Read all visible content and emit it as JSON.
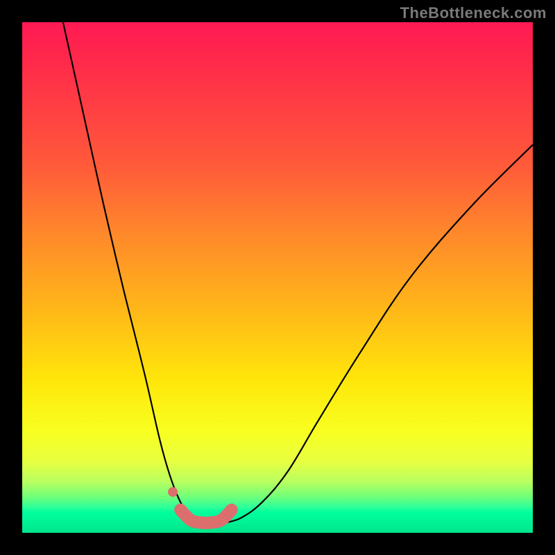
{
  "watermark": "TheBottleneck.com",
  "chart_data": {
    "type": "line",
    "title": "",
    "xlabel": "",
    "ylabel": "",
    "xlim": [
      0,
      100
    ],
    "ylim": [
      0,
      100
    ],
    "series": [
      {
        "name": "left-curve",
        "x": [
          8,
          12,
          16,
          20,
          24,
          27,
          29,
          31,
          33,
          34,
          35
        ],
        "y": [
          100,
          82,
          64,
          47,
          31,
          18,
          11,
          6,
          3,
          2,
          2
        ]
      },
      {
        "name": "right-curve",
        "x": [
          40,
          43,
          47,
          52,
          58,
          66,
          76,
          88,
          100
        ],
        "y": [
          2,
          3,
          6,
          12,
          22,
          35,
          50,
          64,
          76
        ]
      },
      {
        "name": "bottom-arc-main",
        "x": [
          31,
          33,
          35,
          37,
          39,
          41
        ],
        "y": [
          4.5,
          2.5,
          2,
          2,
          2.5,
          4.5
        ]
      },
      {
        "name": "bottom-dot-left",
        "x": [
          29.5
        ],
        "y": [
          8
        ]
      }
    ],
    "styles": {
      "left-curve": {
        "stroke": "#000000",
        "width": 2.2,
        "marker": false
      },
      "right-curve": {
        "stroke": "#000000",
        "width": 2.2,
        "marker": false
      },
      "bottom-arc-main": {
        "stroke": "#dd6e6e",
        "width": 18,
        "marker": false,
        "linecap": "round"
      },
      "bottom-dot-left": {
        "stroke": "#dd6e6e",
        "width": 0,
        "marker": true,
        "marker_r": 7
      }
    },
    "annotations": []
  }
}
